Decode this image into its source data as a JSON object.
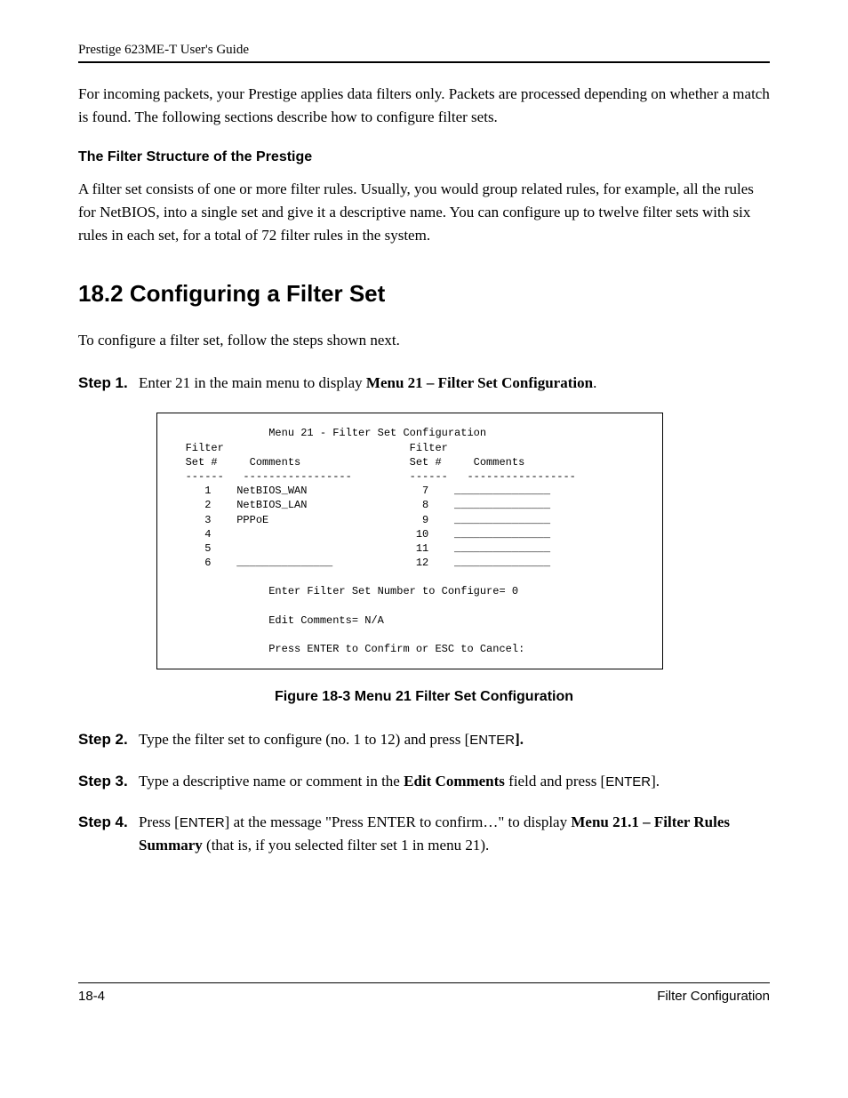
{
  "header": {
    "title": "Prestige 623ME-T User's Guide"
  },
  "intro_para": "For incoming packets, your Prestige applies data filters only. Packets are processed depending on whether a match is found. The following sections describe how to configure filter sets.",
  "subsection_title": "The Filter Structure of the Prestige",
  "subsection_para": "A filter set consists of one or more filter rules. Usually, you would group related rules, for example, all the rules for NetBIOS, into a single set and give it a descriptive name. You can configure up to twelve filter sets with six rules in each set, for a total of 72 filter rules in the system.",
  "section_title": "18.2  Configuring a Filter Set",
  "section_intro": "To configure a filter set, follow the steps shown next.",
  "steps": {
    "s1": {
      "label": "Step 1.",
      "prefix": "Enter 21 in the main menu to display ",
      "bold": "Menu 21 – Filter Set Configuration",
      "suffix": "."
    },
    "s2": {
      "label": "Step 2.",
      "prefix": "Type the filter set to configure (no. 1 to 12) and press [",
      "enter": "ENTER",
      "suffix": "]."
    },
    "s3": {
      "label": "Step 3.",
      "prefix": "Type a descriptive name or comment in the ",
      "bold": "Edit Comments",
      "mid": " field and press [",
      "enter": "ENTER",
      "suffix": "]."
    },
    "s4": {
      "label": "Step 4.",
      "pre1": "Press [",
      "enter": "ENTER",
      "pre2": "] at the message \"Press ENTER to confirm…\" to display ",
      "bold": "Menu 21.1 – Filter Rules Summary",
      "post": " (that is, if you selected filter set 1 in menu 21)."
    }
  },
  "terminal": {
    "title": "Menu 21 - Filter Set Configuration",
    "col1_h1": "Filter",
    "col1_h2": "Set #",
    "col1_h3": "Comments",
    "col2_h1": "Filter",
    "col2_h2": "Set #",
    "col2_h3": "Comments",
    "left": [
      {
        "n": "1",
        "c": "NetBIOS_WAN"
      },
      {
        "n": "2",
        "c": "NetBIOS_LAN"
      },
      {
        "n": "3",
        "c": "PPPoE"
      },
      {
        "n": "4",
        "c": ""
      },
      {
        "n": "5",
        "c": ""
      },
      {
        "n": "6",
        "c": "_______________"
      }
    ],
    "right": [
      {
        "n": "7",
        "c": "_______________"
      },
      {
        "n": "8",
        "c": "_______________"
      },
      {
        "n": "9",
        "c": "_______________"
      },
      {
        "n": "10",
        "c": "_______________"
      },
      {
        "n": "11",
        "c": "_______________"
      },
      {
        "n": "12",
        "c": "_______________"
      }
    ],
    "line_enter": "Enter Filter Set Number to Configure= 0",
    "line_edit": "Edit Comments= N/A",
    "line_press": "Press ENTER to Confirm or ESC to Cancel:"
  },
  "figure_caption": "Figure 18-3 Menu 21 Filter Set Configuration",
  "footer": {
    "page_number": "18-4",
    "section_name": "Filter Configuration"
  }
}
